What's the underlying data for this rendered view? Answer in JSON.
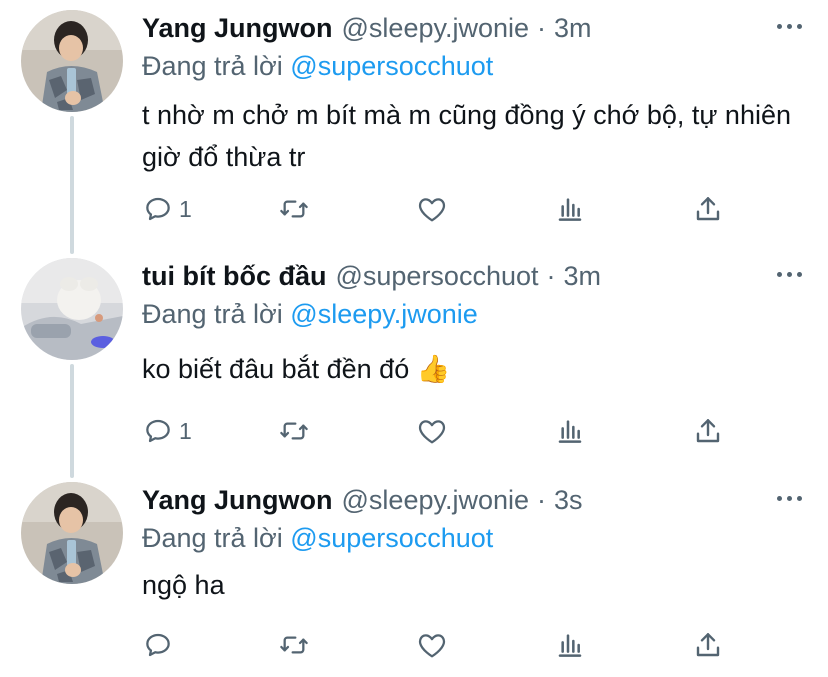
{
  "tweets": [
    {
      "display_name": "Yang Jungwon",
      "handle": "@sleepy.jwonie",
      "separator": "·",
      "time": "3m",
      "replying_prefix": "Đang trả lời",
      "replying_to": "@supersocchuot",
      "text": "t nhờ m chở m bít mà m cũng đồng ý chớ bộ, tự nhiên giờ đổ thừa tr",
      "reply_count": "1",
      "retweet_count": "",
      "like_count": ""
    },
    {
      "display_name": "tui bít bốc đầu",
      "handle": "@supersocchuot",
      "separator": "·",
      "time": "3m",
      "replying_prefix": "Đang trả lời",
      "replying_to": "@sleepy.jwonie",
      "text": "ko biết đâu bắt đền đó 👍",
      "reply_count": "1",
      "retweet_count": "",
      "like_count": ""
    },
    {
      "display_name": "Yang Jungwon",
      "handle": "@sleepy.jwonie",
      "separator": "·",
      "time": "3s",
      "replying_prefix": "Đang trả lời",
      "replying_to": "@supersocchuot",
      "text": "ngộ ha",
      "reply_count": "",
      "retweet_count": "",
      "like_count": ""
    }
  ],
  "icons": {
    "reply": "reply-icon",
    "retweet": "retweet-icon",
    "like": "heart-icon",
    "analytics": "analytics-icon",
    "share": "share-icon",
    "more": "more-icon"
  },
  "colors": {
    "text": "#0f1419",
    "secondary": "#536471",
    "mention": "#1d9bf0",
    "thread_line": "#cfd9de"
  }
}
